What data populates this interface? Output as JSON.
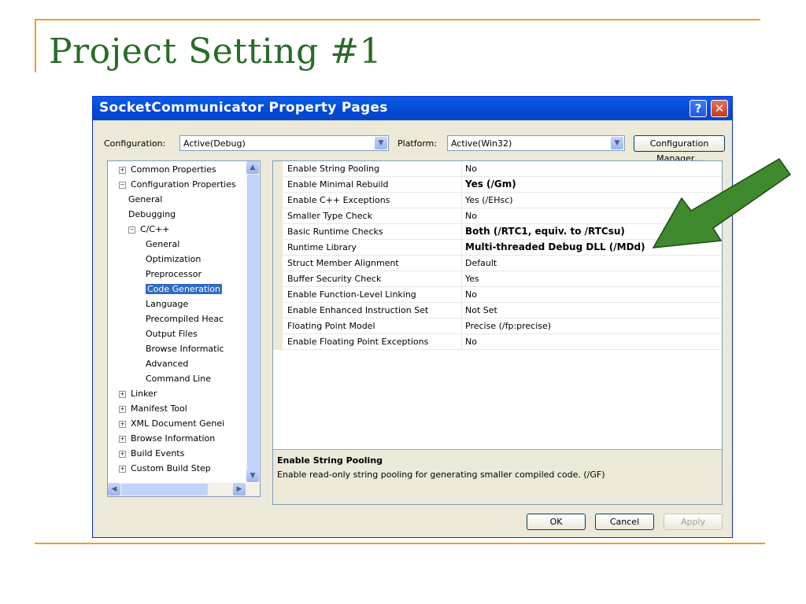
{
  "slide": {
    "title": "Project Setting #1"
  },
  "dialog": {
    "title": "SocketCommunicator Property Pages",
    "help_label": "?",
    "close_label": "✕",
    "configuration_label": "Configuration:",
    "configuration_value": "Active(Debug)",
    "platform_label": "Platform:",
    "platform_value": "Active(Win32)",
    "config_manager_label": "Configuration Manager...",
    "ok_label": "OK",
    "cancel_label": "Cancel",
    "apply_label": "Apply"
  },
  "tree": [
    {
      "label": "Common Properties",
      "toggle": "+"
    },
    {
      "label": "Configuration Properties",
      "toggle": "−"
    },
    {
      "label": "General",
      "toggle": ""
    },
    {
      "label": "Debugging",
      "toggle": ""
    },
    {
      "label": "C/C++",
      "toggle": "−"
    },
    {
      "label": "General",
      "toggle": ""
    },
    {
      "label": "Optimization",
      "toggle": ""
    },
    {
      "label": "Preprocessor",
      "toggle": ""
    },
    {
      "label": "Code Generation",
      "toggle": "",
      "selected": true
    },
    {
      "label": "Language",
      "toggle": ""
    },
    {
      "label": "Precompiled Heac",
      "toggle": ""
    },
    {
      "label": "Output Files",
      "toggle": ""
    },
    {
      "label": "Browse Informatic",
      "toggle": ""
    },
    {
      "label": "Advanced",
      "toggle": ""
    },
    {
      "label": "Command Line",
      "toggle": ""
    },
    {
      "label": "Linker",
      "toggle": "+"
    },
    {
      "label": "Manifest Tool",
      "toggle": "+"
    },
    {
      "label": "XML Document Genei",
      "toggle": "+"
    },
    {
      "label": "Browse Information",
      "toggle": "+"
    },
    {
      "label": "Build Events",
      "toggle": "+"
    },
    {
      "label": "Custom Build Step",
      "toggle": "+"
    }
  ],
  "properties": [
    {
      "name": "Enable String Pooling",
      "value": "No",
      "bold": false
    },
    {
      "name": "Enable Minimal Rebuild",
      "value": "Yes (/Gm)",
      "bold": true
    },
    {
      "name": "Enable C++ Exceptions",
      "value": "Yes (/EHsc)",
      "bold": false
    },
    {
      "name": "Smaller Type Check",
      "value": "No",
      "bold": false
    },
    {
      "name": "Basic Runtime Checks",
      "value": "Both (/RTC1, equiv. to /RTCsu)",
      "bold": true
    },
    {
      "name": "Runtime Library",
      "value": "Multi-threaded Debug DLL (/MDd)",
      "bold": true
    },
    {
      "name": "Struct Member Alignment",
      "value": "Default",
      "bold": false
    },
    {
      "name": "Buffer Security Check",
      "value": "Yes",
      "bold": false
    },
    {
      "name": "Enable Function-Level Linking",
      "value": "No",
      "bold": false
    },
    {
      "name": "Enable Enhanced Instruction Set",
      "value": "Not Set",
      "bold": false
    },
    {
      "name": "Floating Point Model",
      "value": "Precise (/fp:precise)",
      "bold": false
    },
    {
      "name": "Enable Floating Point Exceptions",
      "value": "No",
      "bold": false
    }
  ],
  "description": {
    "title": "Enable String Pooling",
    "text": "Enable read-only string pooling for generating smaller compiled code.    (/GF)"
  },
  "colors": {
    "accent_line": "#e5a324",
    "title_green": "#2a6a2a",
    "arrow_green": "#3f8a2c",
    "titlebar_blue": "#0449d5",
    "selection_blue": "#316ac5"
  }
}
